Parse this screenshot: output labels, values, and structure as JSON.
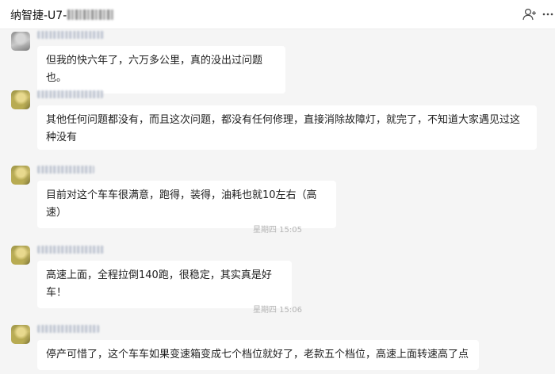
{
  "header": {
    "title": "纳智捷-U7-",
    "icons": [
      "person-add-icon",
      "more-icon"
    ]
  },
  "messages": [
    {
      "text": "但我的快六年了，六万多公里，真的没出过问题也。"
    },
    {
      "text": "其他任何问题都没有，而且这次问题，都没有任何修理，直接消除故障灯，就完了，不知道大家遇见过这种没有"
    },
    {
      "text": "目前对这个车车很满意，跑得，装得，油耗也就10左右（高速）"
    },
    {
      "text": "高速上面，全程拉倒140跑，很稳定，其实真是好车！"
    },
    {
      "text": "停产可惜了，这个车车如果变速箱变成七个档位就好了，老款五个档位，高速上面转速高了点"
    }
  ],
  "timestamps": [
    "星期四  15:05",
    "星期四  15:06"
  ],
  "colors": {
    "chat_bg": "#f5f5f5",
    "bubble_bg": "#ffffff",
    "timestamp": "#b4b4b4"
  }
}
